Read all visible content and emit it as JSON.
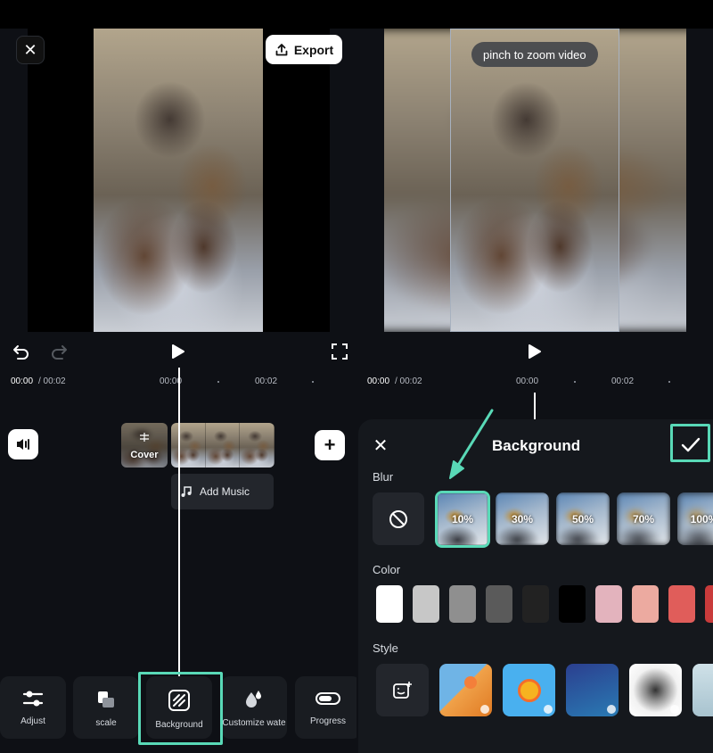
{
  "editor": {
    "export_label": "Export",
    "hint_text": "pinch to zoom video",
    "time_current": "00:00",
    "time_total": "/ 00:02",
    "tick_0": "00:00",
    "tick_1": "00:02",
    "cover_label": "Cover",
    "add_music_label": "Add Music"
  },
  "toolbar": {
    "items": [
      {
        "label": "Adjust",
        "icon": "sliders-icon"
      },
      {
        "label": "scale",
        "icon": "scale-icon"
      },
      {
        "label": "Background",
        "icon": "background-icon"
      },
      {
        "label": "Customize wate",
        "icon": "watermark-icon"
      },
      {
        "label": "Progress",
        "icon": "progress-icon"
      }
    ]
  },
  "background_panel": {
    "title": "Background",
    "blur_label": "Blur",
    "color_label": "Color",
    "style_label": "Style",
    "blur_options": [
      "10%",
      "30%",
      "50%",
      "70%",
      "100%"
    ],
    "selected_blur": "10%",
    "colors": [
      "#ffffff",
      "#c7c7c7",
      "#8f8f8f",
      "#5a5a5a",
      "#222222",
      "#000000",
      "#e3b3bd",
      "#ecaaa0",
      "#e05d5a",
      "#c93b3b"
    ]
  },
  "accent_color": "#59d9b7"
}
